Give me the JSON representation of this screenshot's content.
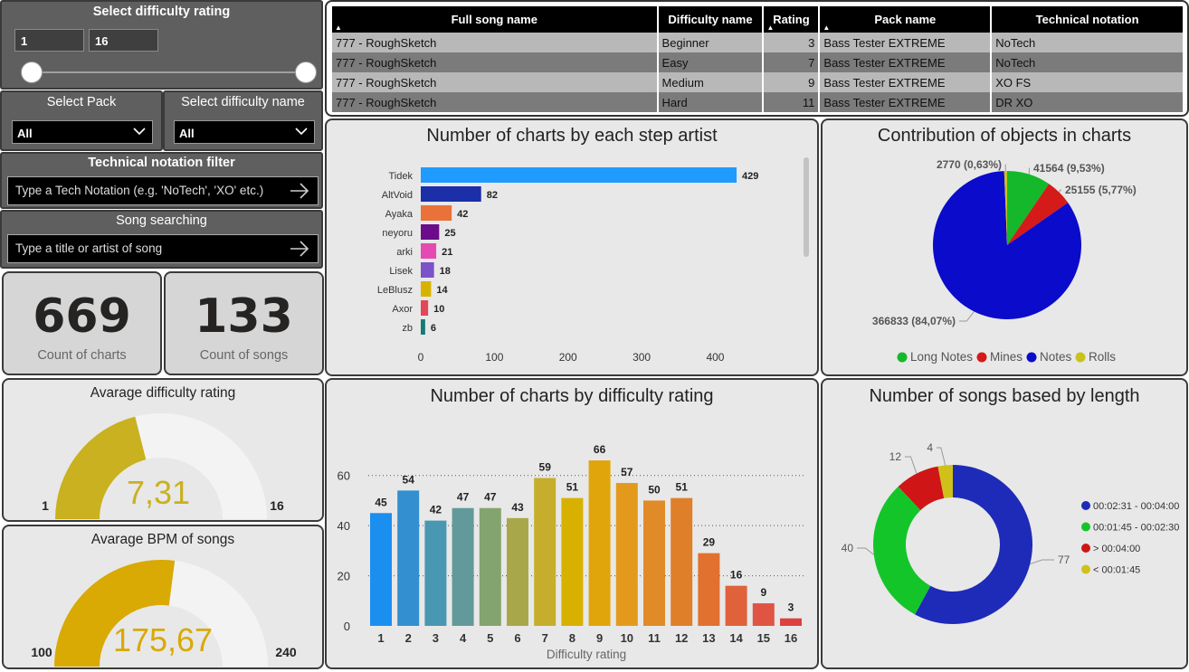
{
  "filters": {
    "difficulty_rating": {
      "title": "Select difficulty rating",
      "min": "1",
      "max": "16"
    },
    "pack": {
      "title": "Select Pack",
      "value": "All"
    },
    "difficulty_name": {
      "title": "Select difficulty name",
      "value": "All"
    },
    "tech_filter": {
      "title": "Technical notation filter",
      "placeholder": "Type a Tech Notation (e.g. 'NoTech', 'XO' etc.)"
    },
    "song_search": {
      "title": "Song searching",
      "placeholder": "Type a title or artist of song"
    }
  },
  "kpis": {
    "charts": {
      "value": "669",
      "label": "Count of charts"
    },
    "songs": {
      "value": "133",
      "label": "Count of songs"
    }
  },
  "gauges": {
    "difficulty": {
      "title": "Avarage difficulty rating",
      "value": "7,31",
      "min": "1",
      "max": "16",
      "fraction": 0.421,
      "color": "#c9b11f"
    },
    "bpm": {
      "title": "Avarage BPM of songs",
      "value": "175,67",
      "min": "100",
      "max": "240",
      "fraction": 0.541,
      "color": "#d9a904"
    }
  },
  "table": {
    "headers": [
      "Full song name",
      "Difficulty name",
      "Rating",
      "Pack name",
      "Technical notation"
    ],
    "rows": [
      [
        "777 - RoughSketch",
        "Beginner",
        "3",
        "Bass Tester EXTREME",
        "NoTech"
      ],
      [
        "777 - RoughSketch",
        "Easy",
        "7",
        "Bass Tester EXTREME",
        "NoTech"
      ],
      [
        "777 - RoughSketch",
        "Medium",
        "9",
        "Bass Tester EXTREME",
        "XO FS"
      ],
      [
        "777 - RoughSketch",
        "Hard",
        "11",
        "Bass Tester EXTREME",
        "DR XO"
      ]
    ]
  },
  "chart_data": [
    {
      "type": "bar",
      "orientation": "horizontal",
      "title": "Number of charts by each step artist",
      "categories": [
        "Tidek",
        "AltVoid",
        "Ayaka",
        "neyoru",
        "arki",
        "Lisek",
        "LeBlusz",
        "Axor",
        "zb"
      ],
      "values": [
        429,
        82,
        42,
        25,
        21,
        18,
        14,
        10,
        6
      ],
      "colors": [
        "#1f9bff",
        "#1b2fa8",
        "#ea7139",
        "#6b0d8a",
        "#e44ab2",
        "#7b52c8",
        "#d7b300",
        "#e2475a",
        "#177a76"
      ],
      "xlim": [
        0,
        440
      ],
      "xticks": [
        0,
        100,
        200,
        300,
        400
      ]
    },
    {
      "type": "pie",
      "title": "Contribution of objects in charts",
      "slices": [
        {
          "name": "Long Notes",
          "value": 41564,
          "label": "41564 (9,53%)",
          "color": "#14b82a"
        },
        {
          "name": "Mines",
          "value": 25155,
          "label": "25155 (5,77%)",
          "color": "#d51a1a"
        },
        {
          "name": "Notes",
          "value": 366833,
          "label": "366833 (84,07%)",
          "color": "#0b0bcb"
        },
        {
          "name": "Rolls",
          "value": 2770,
          "label": "2770 (0,63%)",
          "color": "#c9c21a"
        }
      ],
      "legend": "bottom"
    },
    {
      "type": "bar",
      "title": "Number of charts by difficulty rating",
      "xlabel": "Difficulty rating",
      "categories": [
        "1",
        "2",
        "3",
        "4",
        "5",
        "6",
        "7",
        "8",
        "9",
        "10",
        "11",
        "12",
        "13",
        "14",
        "15",
        "16"
      ],
      "values": [
        45,
        54,
        42,
        47,
        47,
        43,
        59,
        51,
        66,
        57,
        50,
        51,
        29,
        16,
        9,
        3
      ],
      "colors": [
        "#1a8ff0",
        "#338fd0",
        "#4a97b2",
        "#62999b",
        "#83a46e",
        "#a8a84a",
        "#c6ae2c",
        "#d8b000",
        "#e0a50a",
        "#e39a1c",
        "#e08b27",
        "#df7f2a",
        "#e2702e",
        "#e0623b",
        "#e05444",
        "#de3f3f"
      ],
      "ylim": [
        0,
        70
      ],
      "yticks": [
        0,
        20,
        40,
        60
      ],
      "grid": true
    },
    {
      "type": "pie",
      "subtype": "donut",
      "title": "Number of songs based by length",
      "slices": [
        {
          "name": "00:02:31 - 00:04:00",
          "value": 77,
          "color": "#1e2ab8"
        },
        {
          "name": "00:01:45 - 00:02:30",
          "value": 40,
          "color": "#14c52a"
        },
        {
          "name": "> 00:04:00",
          "value": 12,
          "color": "#cf1515"
        },
        {
          "name": "< 00:01:45",
          "value": 4,
          "color": "#cfc11a"
        }
      ],
      "legend": "right"
    }
  ]
}
